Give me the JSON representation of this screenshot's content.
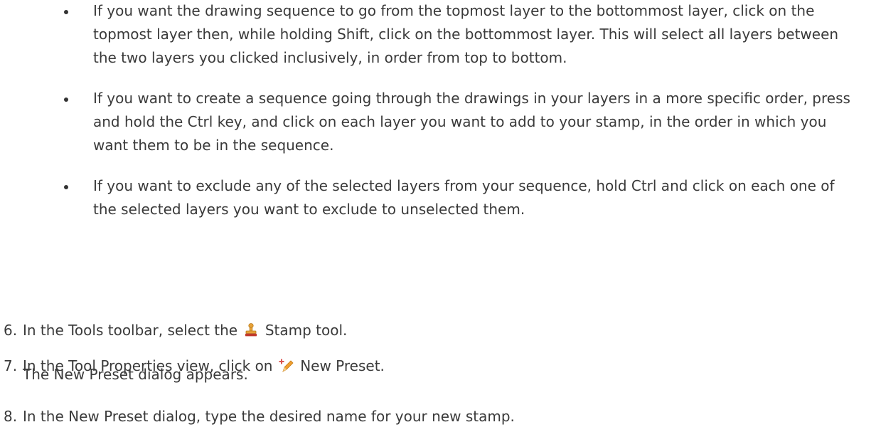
{
  "bullets": [
    {
      "text": "If you want the drawing sequence to go from the topmost layer to the bottommost layer, click on the topmost layer then, while holding Shift, click on the bottommost layer. This will select all layers between the two layers you clicked inclusively, in order from top to bottom."
    },
    {
      "text": "If you want to create a sequence going through the drawings in your layers in a more specific order, press and hold the Ctrl key, and click on each layer you want to add to your stamp, in the order in which you want them to be in the sequence."
    },
    {
      "text": "If you want to exclude any of the selected layers from your sequence, hold Ctrl and click on each one of the selected layers you want to exclude to unselected them."
    }
  ],
  "steps": [
    {
      "number": "6.",
      "before": "In the Tools toolbar, select the",
      "icon": "stamp-icon",
      "after": "Stamp tool."
    },
    {
      "number": "7.",
      "before": "In the Tool Properties view, click on",
      "icon": "new-preset-icon",
      "after": "New Preset."
    },
    {
      "number": "8.",
      "before": "In the New Preset dialog, type the desired name for your new stamp.",
      "icon": "",
      "after": ""
    }
  ],
  "note": "The New Preset dialog appears.",
  "colors": {
    "text": "#3a3a3a",
    "stamp_icon": "#e8a33a",
    "stamp_icon_base": "#c0392b",
    "new_preset_plus": "#d9534f",
    "new_preset_pencil": "#f0a030"
  }
}
